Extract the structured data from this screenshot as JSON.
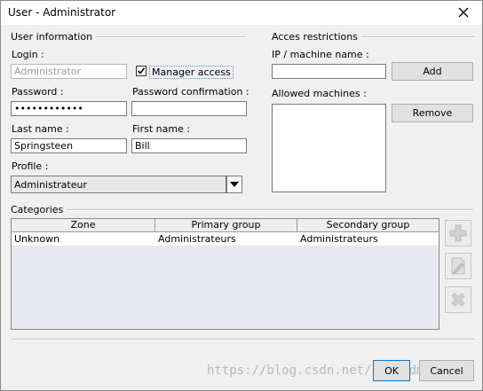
{
  "window": {
    "title": "User - Administrator"
  },
  "user_info": {
    "group_title": "User information",
    "login_label": "Login :",
    "login_value": "Administrator",
    "manager_access_label": "Manager access",
    "manager_access_checked": true,
    "password_label": "Password :",
    "password_value": "••••••••••••",
    "password_confirm_label": "Password confirmation :",
    "password_confirm_value": "",
    "last_name_label": "Last name :",
    "last_name_value": "Springsteen",
    "first_name_label": "First name :",
    "first_name_value": "Bill",
    "profile_label": "Profile :",
    "profile_value": "Administrateur"
  },
  "access": {
    "group_title": "Acces restrictions",
    "ip_label": "IP / machine name :",
    "ip_value": "",
    "add_label": "Add",
    "allowed_label": "Allowed machines :",
    "remove_label": "Remove"
  },
  "categories": {
    "group_title": "Categories",
    "columns": [
      "Zone",
      "Primary group",
      "Secondary group"
    ],
    "rows": [
      [
        "Unknown",
        "Administrateurs",
        "Administrateurs"
      ]
    ]
  },
  "footer": {
    "ok_label": "OK",
    "cancel_label": "Cancel",
    "watermark": "https://blog.csdn.net/lmg_sdmoo"
  },
  "icons": {
    "close": "close-icon",
    "add_row": "plus-icon",
    "edit_row": "edit-icon",
    "delete_row": "delete-icon",
    "dropdown": "chevron-down-icon",
    "check": "check-icon"
  }
}
